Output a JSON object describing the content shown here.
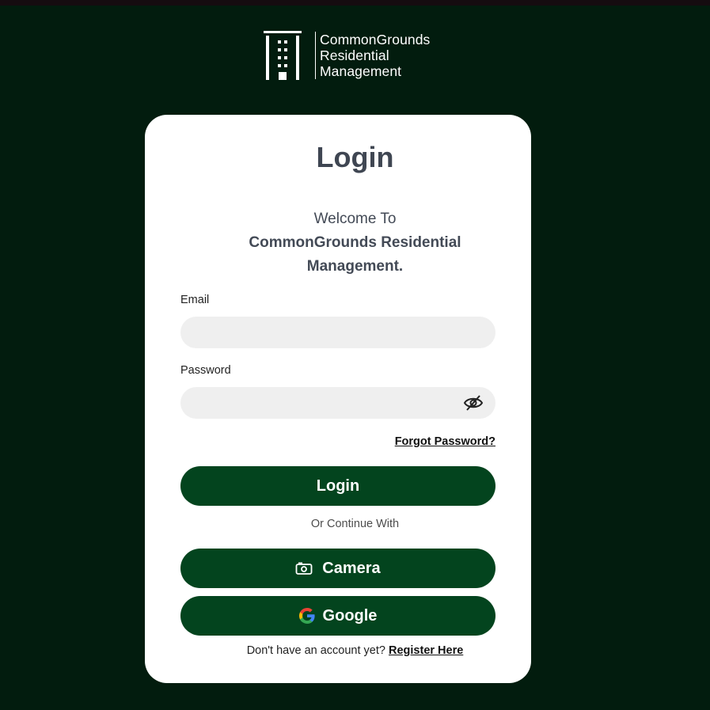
{
  "brand": {
    "line1": "CommonGrounds",
    "line2": "Residential",
    "line3": "Management"
  },
  "login": {
    "title": "Login",
    "welcome_line1": "Welcome To",
    "welcome_line2": "CommonGrounds Residential",
    "welcome_line3": "Management."
  },
  "form": {
    "email_label": "Email",
    "email_value": "",
    "password_label": "Password",
    "password_value": "",
    "forgot_label": "Forgot Password?",
    "login_button": "Login",
    "or_text": "Or Continue With",
    "camera_button": "Camera",
    "google_button": "Google",
    "register_prompt": "Don't have an account yet?",
    "register_link": "Register Here"
  },
  "colors": {
    "background": "#021c0e",
    "button": "#03441e",
    "card": "#ffffff",
    "input": "#efefef"
  },
  "icons": [
    "building-icon",
    "eye-off-icon",
    "camera-icon",
    "google-icon"
  ]
}
